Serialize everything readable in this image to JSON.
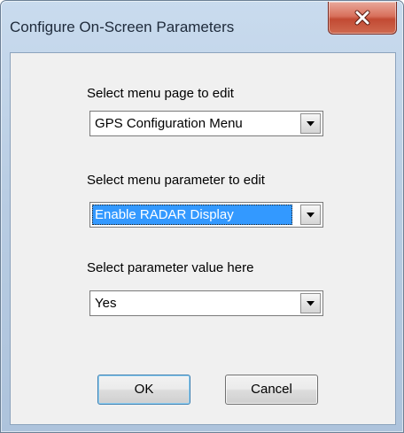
{
  "window": {
    "title": "Configure On-Screen Parameters",
    "close_icon": "close-x-icon"
  },
  "form": {
    "menu_page": {
      "label": "Select menu page to edit",
      "value": "GPS Configuration Menu"
    },
    "menu_parameter": {
      "label": "Select menu parameter to edit",
      "value": "Enable RADAR Display"
    },
    "parameter_value": {
      "label": "Select parameter value here",
      "value": "Yes"
    }
  },
  "buttons": {
    "ok": "OK",
    "cancel": "Cancel"
  },
  "colors": {
    "selection": "#3399ff",
    "close_button": "#c24a33",
    "dialog_face": "#f0f0f0"
  }
}
